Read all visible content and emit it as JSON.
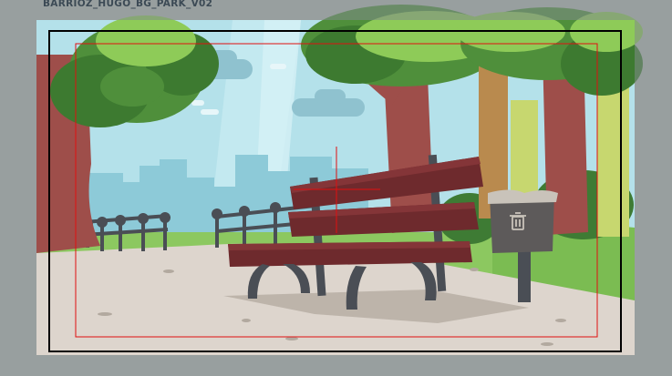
{
  "header": {
    "file_name": "BARRIOZ_HUGO_BG_PARK_V02"
  },
  "viewer": {
    "background": "#b3b8b7",
    "overlay_tint": "rgba(130,138,140,0.55)",
    "safe_frame_color": "#000000",
    "title_safe_color": "#e01010",
    "crosshair_color": "#e01010"
  },
  "scene": {
    "sky_color": "#b4e1ea",
    "grass_color": "#8cc860",
    "path_color": "#ddd5cd",
    "bench_color": "#6e2a2d",
    "trunk_color": "#9e4e4a",
    "foliage_color": "#4f8f3b",
    "trash_can_icon": "trash-can-icon"
  }
}
